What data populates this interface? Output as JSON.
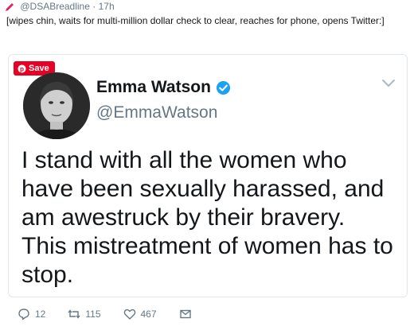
{
  "tweet": {
    "handle": "@DSABreadline",
    "separator": "·",
    "time": "17h",
    "text": "[wipes chin, waits for multi-million dollar check to clear, reaches for phone, opens Twitter:]"
  },
  "embedded": {
    "save_label": "Save",
    "display_name": "Emma Watson",
    "username": "@EmmaWatson",
    "text": "I stand with all the women who have been sexually harassed, and am awestruck by their bravery. This mistreatment of women has to stop."
  },
  "actions": {
    "replies": "12",
    "retweets": "115",
    "likes": "467"
  },
  "colors": {
    "twitter_blue": "#1da1f2",
    "pinterest_red": "#e60023",
    "muted": "#657786"
  }
}
